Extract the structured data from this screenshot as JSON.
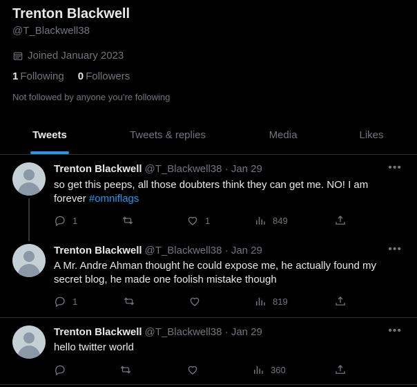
{
  "profile": {
    "name": "Trenton Blackwell",
    "handle": "@T_Blackwell38",
    "joined": "Joined January 2023",
    "following_count": "1",
    "following_label": "Following",
    "followers_count": "0",
    "followers_label": "Followers",
    "not_followed": "Not followed by anyone you’re following"
  },
  "tabs": [
    {
      "label": "Tweets",
      "active": true
    },
    {
      "label": "Tweets & replies",
      "active": false
    },
    {
      "label": "Media",
      "active": false
    },
    {
      "label": "Likes",
      "active": false
    }
  ],
  "tweets": [
    {
      "name": "Trenton Blackwell",
      "meta": "@T_Blackwell38 · Jan 29",
      "text": "so get this peeps, all those doubters think they can get me. NO! I am forever ",
      "hashtag": "#omniflags",
      "replies": "1",
      "retweets": "",
      "likes": "1",
      "views": "849"
    },
    {
      "name": "Trenton Blackwell",
      "meta": "@T_Blackwell38 · Jan 29",
      "text": "A Mr. Andre Ahman thought he could expose me, he actually found my secret blog, he made one foolish mistake though",
      "replies": "1",
      "retweets": "",
      "likes": "",
      "views": "819"
    },
    {
      "name": "Trenton Blackwell",
      "meta": "@T_Blackwell38 · Jan 29",
      "text": "hello twitter world",
      "replies": "",
      "retweets": "",
      "likes": "",
      "views": "360"
    }
  ],
  "icons": {
    "more": "more-dots-icon",
    "reply": "reply-icon",
    "retweet": "retweet-icon",
    "like": "heart-icon",
    "views": "views-icon",
    "share": "share-icon",
    "calendar": "calendar-icon"
  },
  "colors": {
    "background": "#000000",
    "text": "#e7e9ea",
    "muted": "#71767b",
    "accent": "#1d9bf0",
    "border": "#2f3336"
  }
}
